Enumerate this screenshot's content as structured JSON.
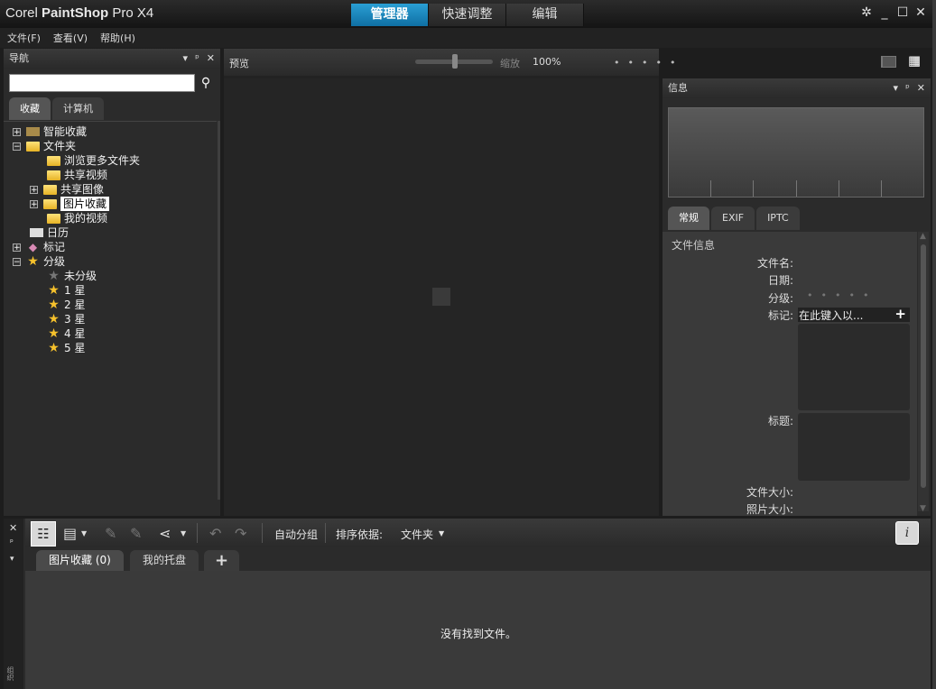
{
  "app": {
    "brand_corel": "Corel ",
    "brand_bold": "PaintShop",
    "brand_rest": " Pro X4",
    "mode_tabs": [
      "管理器",
      "快速调整",
      "编辑"
    ],
    "window_buttons": [
      "✲",
      "_",
      "☐",
      "✕"
    ]
  },
  "menu": [
    "文件(F)",
    "查看(V)",
    "帮助(H)"
  ],
  "navigation": {
    "title": "导航",
    "tabs": [
      "收藏",
      "计算机"
    ],
    "tree": [
      {
        "label": "智能收藏",
        "icon": "smart-collection-icon"
      },
      {
        "label": "文件夹",
        "icon": "folder-icon"
      },
      {
        "label": "浏览更多文件夹",
        "icon": "browse-folder-icon"
      },
      {
        "label": "共享视频",
        "icon": "folder-icon"
      },
      {
        "label": "共享图像",
        "icon": "folder-icon"
      },
      {
        "label": "图片收藏",
        "icon": "folder-icon"
      },
      {
        "label": "我的视频",
        "icon": "folder-icon"
      },
      {
        "label": "日历",
        "icon": "calendar-icon"
      },
      {
        "label": "标记",
        "icon": "tag-icon"
      },
      {
        "label": "分级",
        "icon": "star-icon"
      },
      {
        "label": "未分级",
        "icon": "star-icon"
      },
      {
        "label": "1 星",
        "icon": "star-icon"
      },
      {
        "label": "2 星",
        "icon": "star-icon"
      },
      {
        "label": "3 星",
        "icon": "star-icon"
      },
      {
        "label": "4 星",
        "icon": "star-icon"
      },
      {
        "label": "5 星",
        "icon": "star-icon"
      }
    ]
  },
  "preview": {
    "title": "预览",
    "zoom_label": "缩放",
    "zoom_value": "100%"
  },
  "info": {
    "title": "信息",
    "tabs": [
      "常规",
      "EXIF",
      "IPTC"
    ],
    "section": "文件信息",
    "fields": {
      "filename": "文件名:",
      "date": "日期:",
      "rating": "分级:",
      "tags": "标记:",
      "tag_placeholder": "在此键入以...",
      "caption": "标题:",
      "filesize": "文件大小:",
      "photosize": "照片大小:"
    }
  },
  "organizer": {
    "auto_group": "自动分组",
    "sort_by": "排序依据:",
    "sort_value": "文件夹",
    "tabs": [
      "图片收藏 (0)",
      "我的托盘"
    ],
    "empty_message": "没有找到文件。",
    "side_label": "组织"
  }
}
